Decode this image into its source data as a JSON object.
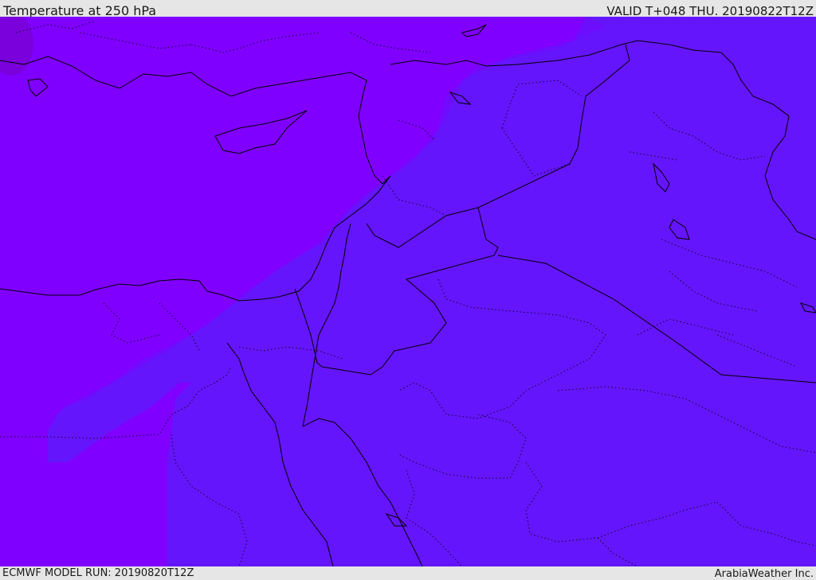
{
  "header": {
    "title": "Temperature at 250 hPa",
    "valid": "VALID T+048 THU. 20190822T12Z"
  },
  "footer": {
    "model_run": "ECMWF MODEL RUN: 20190820T12Z",
    "credit": "ArabiaWeather Inc."
  },
  "map": {
    "colors": {
      "warmer_band": "#8000ff",
      "cooler_band": "#6515fb",
      "transition_band": "#6e0cfe",
      "border_line": "#000000"
    },
    "icons": []
  }
}
